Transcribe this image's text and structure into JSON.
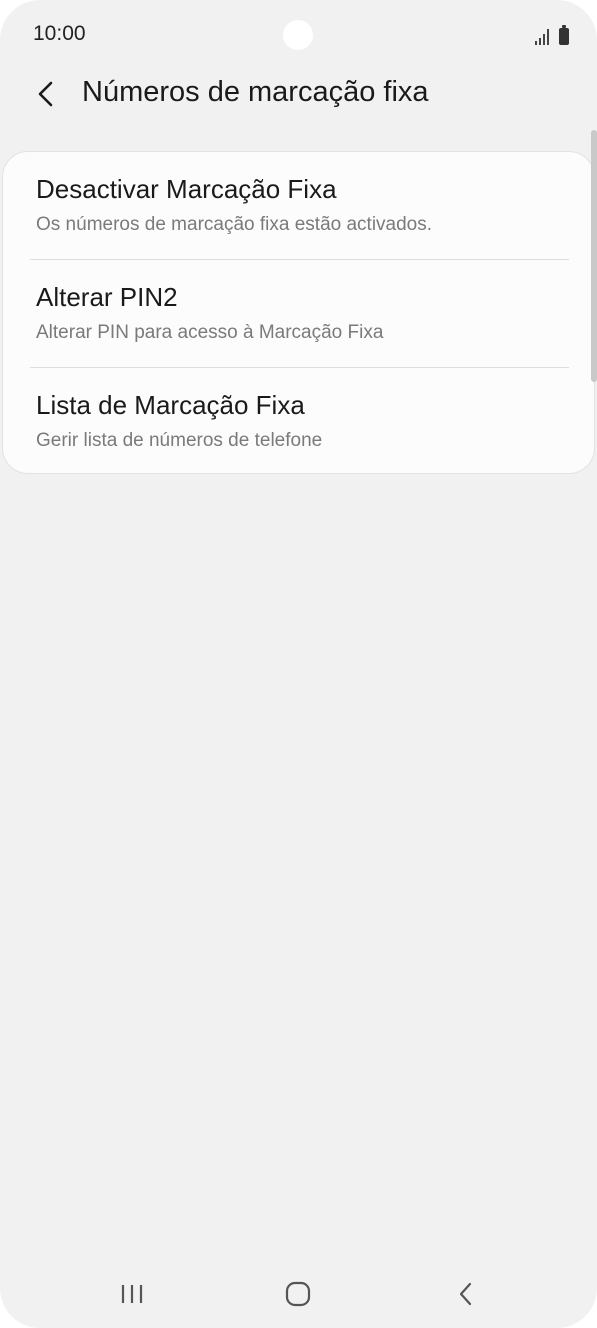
{
  "status_bar": {
    "time": "10:00",
    "icons": [
      "signal-icon",
      "battery-icon"
    ]
  },
  "header": {
    "back_icon": "chevron-left-icon",
    "title": "Números de marcação fixa"
  },
  "settings": [
    {
      "title": "Desactivar Marcação Fixa",
      "subtitle": "Os números de marcação fixa estão activados."
    },
    {
      "title": "Alterar PIN2",
      "subtitle": "Alterar PIN para acesso à Marcação Fixa"
    },
    {
      "title": "Lista de Marcação Fixa",
      "subtitle": "Gerir lista de números de telefone"
    }
  ],
  "nav_bar": {
    "icons": [
      "recent-apps-icon",
      "home-icon",
      "back-icon"
    ]
  },
  "colors": {
    "background": "#f1f1f1",
    "card": "#fcfcfc",
    "primary_text": "#1a1a1a",
    "secondary_text": "#7a7a7a"
  }
}
